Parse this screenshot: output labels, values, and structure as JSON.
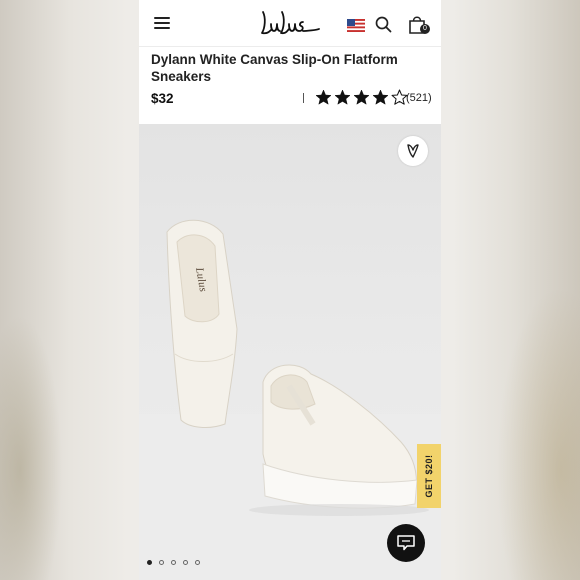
{
  "header": {
    "menu_icon": "hamburger-menu-icon",
    "logo_text": "Lulus",
    "flag_icon": "us-flag-icon",
    "search_icon": "search-icon",
    "cart_icon": "shopping-bag-icon",
    "cart_count": "0"
  },
  "product": {
    "title": "Dylann White Canvas Slip-On Flatform Sneakers",
    "price": "$32",
    "rating": 4,
    "rating_max": 5,
    "review_count": "(521)"
  },
  "gallery": {
    "image": "white canvas slip-on flatform sneakers",
    "wishlist_icon": "heart-icon",
    "promo_label": "GET $20!",
    "chat_icon": "chat-bubble-icon",
    "slide_count": 5,
    "active_slide": 1
  },
  "colors": {
    "promo": "#f2d36b",
    "text": "#222222",
    "chat_button": "#111111"
  }
}
